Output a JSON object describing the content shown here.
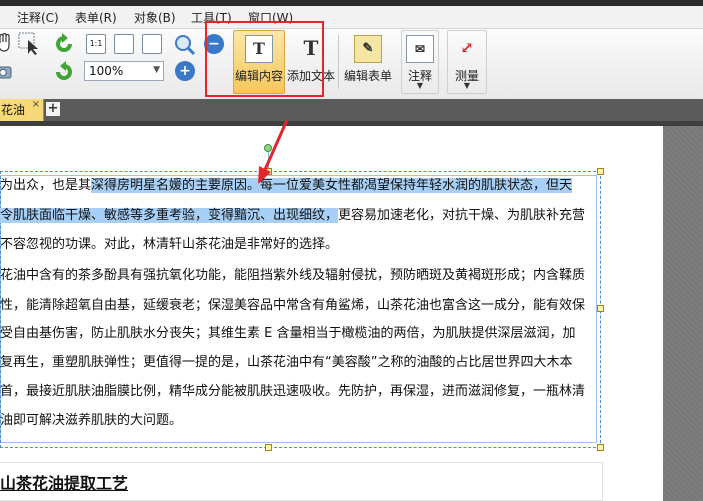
{
  "menu": {
    "items": [
      {
        "label": "注释(C)"
      },
      {
        "label": "表单(R)"
      },
      {
        "label": "对象(B)"
      },
      {
        "label": "工具(T)"
      },
      {
        "label": "窗口(W)"
      }
    ]
  },
  "toolbar": {
    "zoom_value": "100%",
    "edit_content_label": "编辑内容",
    "add_text_label": "添加文本",
    "edit_form_label": "编辑表单",
    "annotate_label": "注释",
    "measure_label": "测量"
  },
  "tabs": {
    "active_label": "花油",
    "close_glyph": "×",
    "new_tab_glyph": "+"
  },
  "document": {
    "lines": [
      {
        "pre": "为出众，也是其",
        "hl": "深得房明星名媛的主要原因。每一位爱美女性都渴望保持年轻水润的肌肤状态，但天",
        "post": ""
      },
      {
        "pre": "",
        "hl": "令肌肤面临干燥、敏感等多重考验，变得黯沉、出现细纹，",
        "post": "更容易加速老化，对抗干燥、为肌肤补充营"
      },
      {
        "pre": "不容忽视的功课。对此，林清轩山茶花油是非常好的选择。",
        "hl": "",
        "post": ""
      },
      {
        "pre": "花油中含有的茶多酚具有强抗氧化功能，能阻挡紫外线及辐射侵扰，预防晒斑及黄褐斑形成；内含鞣质",
        "hl": "",
        "post": ""
      },
      {
        "pre": "性，能清除超氧自由基，延缓衰老；保湿美容品中常含有角鲨烯，山茶花油也富含这一成分，能有效保",
        "hl": "",
        "post": ""
      },
      {
        "pre": "受自由基伤害，防止肌肤水分丧失；其维生素 E 含量相当于橄榄油的两倍，为肌肤提供深层滋润，加",
        "hl": "",
        "post": ""
      },
      {
        "pre": "复再生，重塑肌肤弹性；更值得一提的是，山茶花油中有“美容酸”之称的油酸的占比居世界四大木本",
        "hl": "",
        "post": ""
      },
      {
        "pre": "首，最接近肌肤油脂膜比例，精华成分能被肌肤迅速吸收。先防护，再保湿，进而滋润修复，一瓶林清",
        "hl": "",
        "post": ""
      },
      {
        "pre": "油即可解决滋养肌肤的大问题。",
        "hl": "",
        "post": ""
      }
    ],
    "section_title": "山茶花油提取工艺"
  },
  "colors": {
    "highlight": "#a8d0f7",
    "annotation_red": "#e3262b",
    "active_button": "#f6c75d",
    "tab_active": "#f7d978"
  }
}
